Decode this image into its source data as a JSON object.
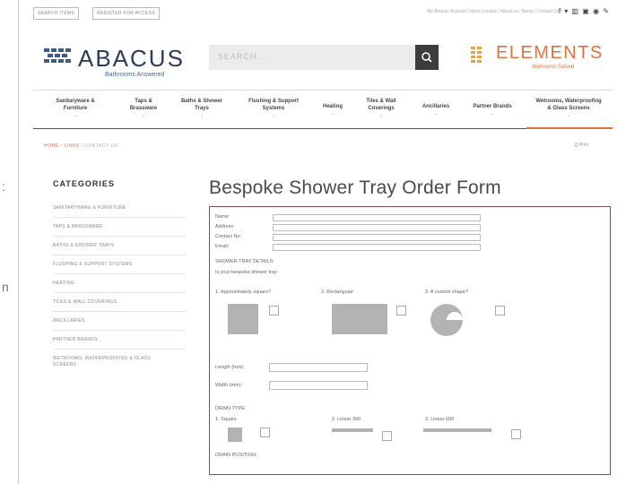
{
  "left_edge": {
    "chars": [
      ":",
      "n"
    ]
  },
  "topbar": {
    "btn1": "SEARCH ITEMS",
    "btn2": "REGISTER FOR ACCESS",
    "links": "My Abacus Account / Store Locator / About us / News / Contact Us /",
    "social": "f ▾ ▥ ▣ ◉ ✎"
  },
  "brand": {
    "name": "ABACUS",
    "tagline": "Bathrooms Answered"
  },
  "search": {
    "placeholder": "SEARCH..."
  },
  "elements": {
    "name": "ELEMENTS",
    "tagline": "Wetrooms Solved"
  },
  "nav": [
    {
      "label": "Sanitaryware &\nFurniture"
    },
    {
      "label": "Taps &\nBrassware"
    },
    {
      "label": "Baths & Shower\nTrays"
    },
    {
      "label": "Flushing & Support\nSystems"
    },
    {
      "label": "Heating"
    },
    {
      "label": "Tiles & Wall\nCoverings"
    },
    {
      "label": "Ancillaries"
    },
    {
      "label": "Partner Brands"
    },
    {
      "label": "Wetrooms, Waterproofing\n& Glass Screens"
    }
  ],
  "breadcrumb": {
    "home": "HOME",
    "sep1": "/",
    "links": "LINKS",
    "sep2": "/",
    "current": "CONTACT US"
  },
  "print_label": "Print",
  "categories": {
    "title": "CATEGORIES",
    "items": [
      "SANITARYWARE & FURNITURE",
      "TAPS & BRASSWARE",
      "BATHS & SHOWER TRAYS",
      "FLUSHING & SUPPORT SYSTEMS",
      "HEATING",
      "TILES & WALL COVERINGS",
      "ANCILLARIES",
      "PARTNER BRANDS",
      "WETROOMS, WATERPROOFING & GLASS\nSCREENS"
    ]
  },
  "form": {
    "title": "Bespoke Shower Tray Order Form",
    "name_label": "Name:",
    "address_label": "Address:",
    "contact_label": "Contact No:",
    "email_label": "Email:",
    "tray_details": "SHOWER TRAY DETAILS:",
    "is_your": "Is your bespoke shower tray",
    "q1": "1. Approximately square?",
    "q2": "2. Rectangular",
    "q3": "3. A custom shape?",
    "length_label": "Length (mm):",
    "width_label": "Width (mm):",
    "drain_type": "DRAIN TYPE:",
    "d1": "1. Square",
    "d2": "2. Linear 300",
    "d3": "3. Linear 600",
    "drain_position": "DRAIN POSITION:"
  }
}
